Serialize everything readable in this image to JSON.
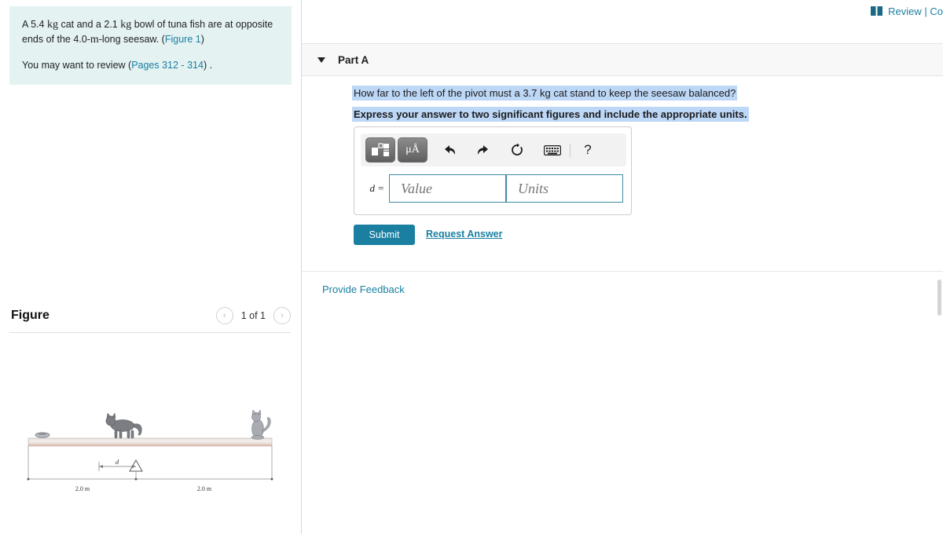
{
  "left_panel": {
    "problem": {
      "line1_a": "A 5.4 ",
      "line1_unit": "kg",
      "line1_b": " cat and a 2.1 ",
      "line1_unit2": "kg",
      "line1_c": " bowl of tuna fish are at opposite ends of the 4.0-",
      "line1_unit3": "m",
      "line1_d": "-long seesaw. (",
      "figure_link": "Figure 1",
      "line1_e": ")",
      "line2_a": "You may want to review (",
      "pages_link": "Pages 312 - 314",
      "line2_b": ") ."
    },
    "figure": {
      "title": "Figure",
      "prev_label": "‹",
      "next_label": "›",
      "count": "1 of 1",
      "labels": {
        "left_span": "2.0 m",
        "right_span": "2.0 m",
        "distance": "d"
      }
    }
  },
  "right_panel": {
    "review": {
      "text": "Review | Co",
      "icon": "book-icon"
    },
    "part": {
      "label": "Part A",
      "caret": "caret-down-icon",
      "question": "How far to the left of the pivot must a 3.7 kg cat stand to keep the seesaw balanced?",
      "instruction": "Express your answer to two significant figures and include the appropriate units."
    },
    "answer": {
      "variable_label": "d =",
      "value_placeholder": "Value",
      "units_placeholder": "Units",
      "value_current": "",
      "units_current": "",
      "toolbar": [
        {
          "name": "math-template-button",
          "glyph": "■"
        },
        {
          "name": "units-button",
          "glyph": "μÅ"
        },
        {
          "name": "undo-button",
          "glyph": "↶"
        },
        {
          "name": "redo-button",
          "glyph": "↷"
        },
        {
          "name": "reset-button",
          "glyph": "↺"
        },
        {
          "name": "keyboard-button",
          "glyph": "⌨"
        },
        {
          "name": "help-button",
          "glyph": "?"
        }
      ]
    },
    "actions": {
      "submit_label": "Submit",
      "request_answer_label": "Request Answer",
      "provide_feedback_label": "Provide Feedback"
    }
  },
  "colors": {
    "accent": "#1a7fa0",
    "problem_bg": "#e4f2f2",
    "selection": "#bdd7f7",
    "header_bg": "#f8f8f8"
  }
}
